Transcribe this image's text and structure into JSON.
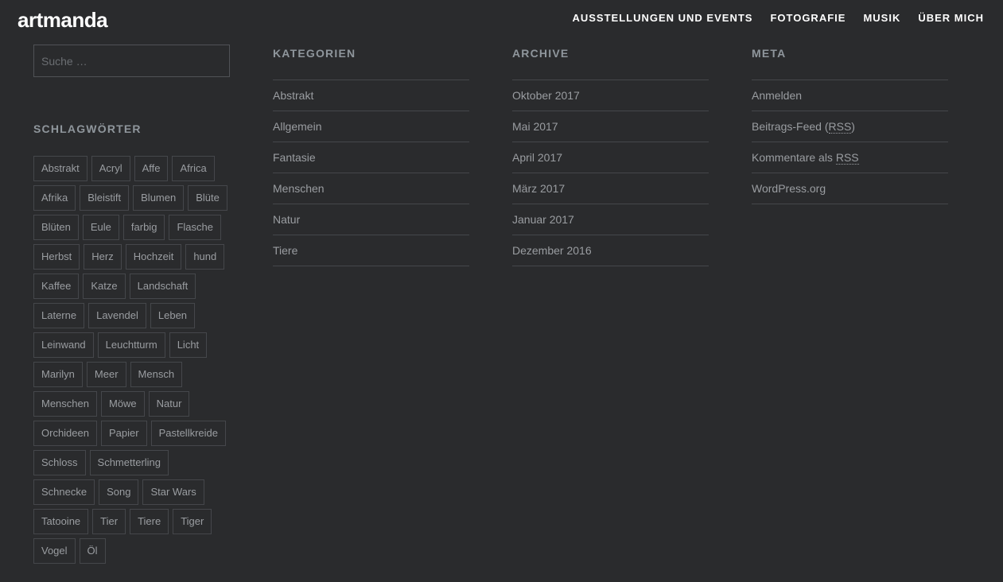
{
  "site": {
    "title": "artmanda"
  },
  "nav": [
    {
      "label": "AUSSTELLUNGEN UND EVENTS"
    },
    {
      "label": "FOTOGRAFIE"
    },
    {
      "label": "MUSIK"
    },
    {
      "label": "ÜBER MICH"
    }
  ],
  "search": {
    "placeholder": "Suche …",
    "value": ""
  },
  "tags": {
    "title": "SCHLAGWÖRTER",
    "items": [
      "Abstrakt",
      "Acryl",
      "Affe",
      "Africa",
      "Afrika",
      "Bleistift",
      "Blumen",
      "Blüte",
      "Blüten",
      "Eule",
      "farbig",
      "Flasche",
      "Herbst",
      "Herz",
      "Hochzeit",
      "hund",
      "Kaffee",
      "Katze",
      "Landschaft",
      "Laterne",
      "Lavendel",
      "Leben",
      "Leinwand",
      "Leuchtturm",
      "Licht",
      "Marilyn",
      "Meer",
      "Mensch",
      "Menschen",
      "Möwe",
      "Natur",
      "Orchideen",
      "Papier",
      "Pastellkreide",
      "Schloss",
      "Schmetterling",
      "Schnecke",
      "Song",
      "Star Wars",
      "Tatooine",
      "Tier",
      "Tiere",
      "Tiger",
      "Vogel",
      "Öl"
    ]
  },
  "categories": {
    "title": "KATEGORIEN",
    "items": [
      "Abstrakt",
      "Allgemein",
      "Fantasie",
      "Menschen",
      "Natur",
      "Tiere"
    ]
  },
  "archive": {
    "title": "ARCHIVE",
    "items": [
      "Oktober 2017",
      "Mai 2017",
      "April 2017",
      "März 2017",
      "Januar 2017",
      "Dezember 2016"
    ]
  },
  "meta": {
    "title": "META",
    "login": "Anmelden",
    "feed": "Beitrags-Feed",
    "feed_abbr": "RSS",
    "comments": "Kommentare als",
    "comments_abbr": "RSS",
    "wordpress": "WordPress.org"
  },
  "colors": {
    "background": "#2a2b2d",
    "text": "#9a9da1",
    "heading": "#8f969c",
    "border": "#45474b"
  }
}
